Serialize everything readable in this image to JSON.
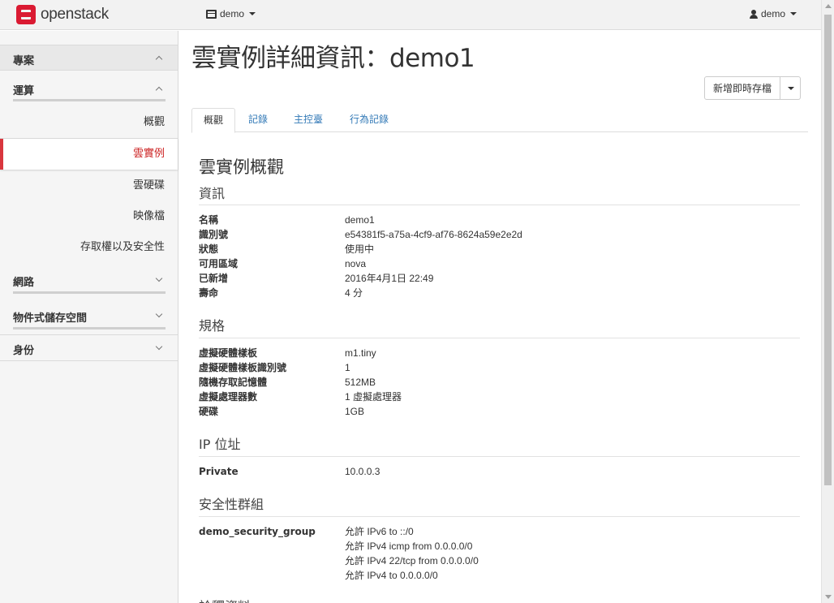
{
  "navbar": {
    "brand": "openstack",
    "project": "demo",
    "user": "demo"
  },
  "sidebar": {
    "project_heading": "專案",
    "compute_heading": "運算",
    "compute_items": [
      "概觀",
      "雲實例",
      "雲硬碟",
      "映像檔",
      "存取權以及安全性"
    ],
    "active_item": "雲實例",
    "network_heading": "網路",
    "object_storage_heading": "物件式儲存空間",
    "identity_heading": "身份"
  },
  "page": {
    "title": "雲實例詳細資訊：demo1",
    "snapshot_button": "新增即時存檔",
    "tabs": [
      "概觀",
      "記錄",
      "主控臺",
      "行為記錄"
    ],
    "active_tab": "概觀"
  },
  "overview": {
    "title": "雲實例概觀",
    "info": {
      "title": "資訊",
      "rows": [
        {
          "key": "名稱",
          "value": "demo1"
        },
        {
          "key": "識別號",
          "value": "e54381f5-a75a-4cf9-af76-8624a59e2e2d"
        },
        {
          "key": "狀態",
          "value": "使用中"
        },
        {
          "key": "可用區域",
          "value": "nova"
        },
        {
          "key": "已新增",
          "value": "2016年4月1日 22:49"
        },
        {
          "key": "壽命",
          "value": "4 分"
        }
      ]
    },
    "specs": {
      "title": "規格",
      "rows": [
        {
          "key": "虛擬硬體樣板",
          "value": "m1.tiny"
        },
        {
          "key": "虛擬硬體樣板識別號",
          "value": "1"
        },
        {
          "key": "隨機存取記憶體",
          "value": "512MB"
        },
        {
          "key": "虛擬處理器數",
          "value": "1 虛擬處理器"
        },
        {
          "key": "硬碟",
          "value": "1GB"
        }
      ]
    },
    "ip": {
      "title": "IP 位址",
      "rows": [
        {
          "key": "Private",
          "value": "10.0.0.3"
        }
      ]
    },
    "security": {
      "title": "安全性群組",
      "group": "demo_security_group",
      "rules": [
        "允許 IPv6 to ::/0",
        "允許 IPv4 icmp from 0.0.0.0/0",
        "允許 IPv4 22/tcp from 0.0.0.0/0",
        "允許 IPv4 to 0.0.0.0/0"
      ]
    },
    "metadata_title": "詮釋資料"
  }
}
